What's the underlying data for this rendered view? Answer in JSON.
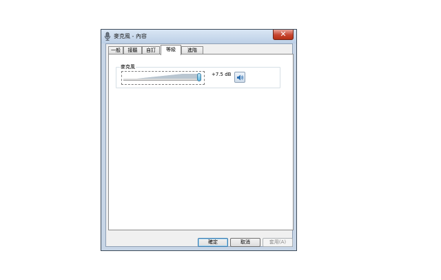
{
  "window": {
    "title": "麥克風 - 內容",
    "close_glyph": "✕"
  },
  "tabs": [
    {
      "label": "一般",
      "active": false
    },
    {
      "label": "接聽",
      "active": false
    },
    {
      "label": "自訂",
      "active": false
    },
    {
      "label": "等級",
      "active": true
    },
    {
      "label": "進階",
      "active": false
    }
  ],
  "levels": {
    "group_label": "麥克風",
    "level_text": "+7.5 dB",
    "slider_fraction": 1.0,
    "mute_icon": "speaker-icon"
  },
  "buttons": {
    "ok": "確定",
    "cancel": "取消",
    "apply": "套用(A)"
  }
}
